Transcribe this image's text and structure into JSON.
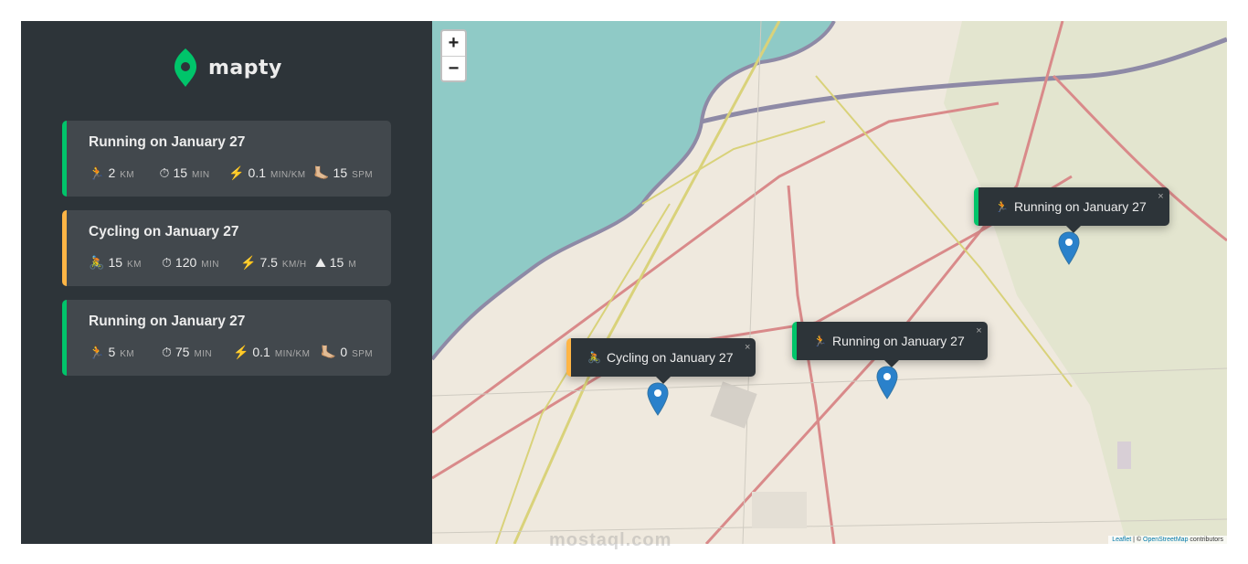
{
  "brand": {
    "name": "mapty",
    "color": "#00c46a"
  },
  "colors": {
    "running": "#00c46a",
    "cycling": "#ffb545",
    "sidebar_bg": "#2d3439",
    "card_bg": "#42484d"
  },
  "workouts": [
    {
      "type": "running",
      "title": "Running on January 27",
      "icon": "🏃",
      "d1": {
        "icon": "🏃",
        "value": "2",
        "unit": "KM"
      },
      "d2": {
        "icon": "⏱",
        "value": "15",
        "unit": "MIN"
      },
      "d3": {
        "icon": "⚡️",
        "value": "0.1",
        "unit": "MIN/KM"
      },
      "d4": {
        "icon": "🦶🏼",
        "value": "15",
        "unit": "SPM"
      }
    },
    {
      "type": "cycling",
      "title": "Cycling on January 27",
      "icon": "🚴",
      "d1": {
        "icon": "🚴",
        "value": "15",
        "unit": "KM"
      },
      "d2": {
        "icon": "⏱",
        "value": "120",
        "unit": "MIN"
      },
      "d3": {
        "icon": "⚡️",
        "value": "7.5",
        "unit": "KM/H"
      },
      "d4": {
        "icon": "⛰",
        "value": "15",
        "unit": "M"
      }
    },
    {
      "type": "running",
      "title": "Running on January 27",
      "icon": "🏃",
      "d1": {
        "icon": "🏃",
        "value": "5",
        "unit": "KM"
      },
      "d2": {
        "icon": "⏱",
        "value": "75",
        "unit": "MIN"
      },
      "d3": {
        "icon": "⚡️",
        "value": "0.1",
        "unit": "MIN/KM"
      },
      "d4": {
        "icon": "🦶🏼",
        "value": "0",
        "unit": "SPM"
      }
    }
  ],
  "map": {
    "zoom_in": "+",
    "zoom_out": "−",
    "popups": [
      {
        "type": "running",
        "icon": "🏃",
        "text": "Running on January 27",
        "close": "×"
      },
      {
        "type": "running",
        "icon": "🏃",
        "text": "Running on January 27",
        "close": "×"
      },
      {
        "type": "cycling",
        "icon": "🚴",
        "text": "Cycling on January 27",
        "close": "×"
      }
    ],
    "attribution": {
      "leaflet": "Leaflet",
      "separator": " | © ",
      "osm": "OpenStreetMap",
      "suffix": " contributors"
    }
  },
  "watermark": "mostaql.com"
}
